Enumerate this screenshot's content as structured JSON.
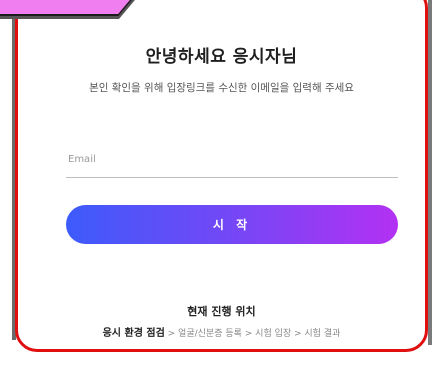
{
  "heading": {
    "title": "안녕하세요 응시자님",
    "subtitle": "본인 확인을 위해 입장링크를 수신한 이메일을 입력해 주세요"
  },
  "form": {
    "email_placeholder": "Email",
    "start_label": "시 작"
  },
  "progress": {
    "title": "현재 진행 위치",
    "current_step": "응시 환경 점검",
    "remaining_steps": " > 얼굴/신분증 등록 > 시험 입장 > 시험 결과"
  },
  "colors": {
    "frame_border": "#e01010",
    "corner_tab": "#f07ef0",
    "button_gradient_start": "#3d5bfb",
    "button_gradient_end": "#b331f3"
  }
}
